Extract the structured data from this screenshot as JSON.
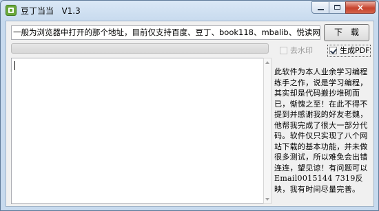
{
  "window": {
    "title": "豆丁当当   V1.3",
    "controls": {
      "minimize": "minimize",
      "maximize": "maximize",
      "close": "×"
    }
  },
  "toolbar": {
    "url_value": "一般为浏览器中打开的那个地址，目前仅支持百度、豆丁、book118、mbalib、悦读网、畅",
    "download_label": "下　载"
  },
  "progress": {
    "value_percent": 0
  },
  "options": {
    "watermark_label": "去水印",
    "watermark_checked": false,
    "watermark_enabled": false,
    "pdf_label": "生成PDF",
    "pdf_checked": true
  },
  "log": {
    "text": ""
  },
  "notice": {
    "text": "此软件为本人业余学习编程练手之作，说是学习编程，其实却是代码搬抄堆砌而已，惭愧之至！在此不得不提到并感谢我的好友老魏，他帮我完成了很大一部分代码。软件仅只实现了八个网站下载的基本功能，并未做很多测试，所以难免会出错连连，望见谅！有问题可以Email0015144 7319反映，我有时间尽量完善。"
  },
  "colors": {
    "title_bar": "#c7daee",
    "close_button": "#c7432d",
    "client_bg": "#f0f0f0"
  }
}
